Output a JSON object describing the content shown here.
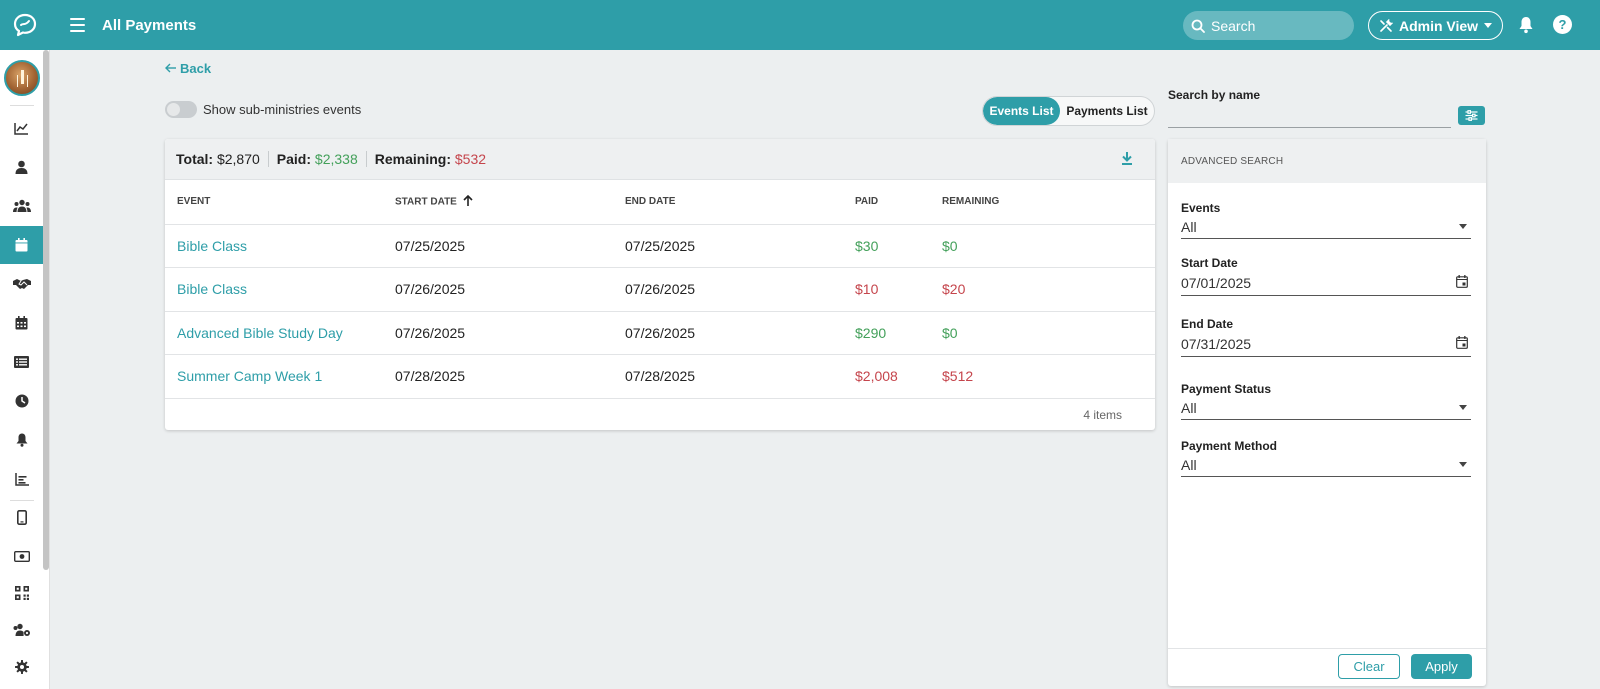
{
  "header": {
    "title": "All Payments",
    "search_placeholder": "Search",
    "admin_view_label": "Admin View",
    "help_label": "?"
  },
  "sidebar": {
    "items": [
      {
        "icon": "line-chart-icon"
      },
      {
        "icon": "person-icon"
      },
      {
        "icon": "group-icon"
      },
      {
        "icon": "calendar-icon",
        "active": true
      },
      {
        "icon": "handshake-icon"
      },
      {
        "icon": "calendar-grid-icon"
      },
      {
        "icon": "list-icon"
      },
      {
        "icon": "clock-icon"
      },
      {
        "icon": "bell-icon"
      },
      {
        "icon": "bar-chart-icon"
      },
      {
        "icon": "phone-icon"
      },
      {
        "icon": "money-icon"
      },
      {
        "icon": "qr-code-icon"
      },
      {
        "icon": "users-gear-icon"
      },
      {
        "icon": "gear-icon"
      }
    ]
  },
  "main": {
    "back_label": "Back",
    "toggle_label": "Show sub-ministries events",
    "view_tabs": [
      {
        "label": "Events List",
        "active": true
      },
      {
        "label": "Payments List",
        "active": false
      }
    ],
    "summary": {
      "total_label": "Total:",
      "total_value": "$2,870",
      "paid_label": "Paid:",
      "paid_value": "$2,338",
      "remaining_label": "Remaining:",
      "remaining_value": "$532"
    },
    "table": {
      "columns": [
        "EVENT",
        "START DATE",
        "END DATE",
        "PAID",
        "REMAINING"
      ],
      "rows": [
        {
          "event": "Bible Class",
          "start": "07/25/2025",
          "end": "07/25/2025",
          "paid": "$30",
          "remaining": "$0",
          "paid_status": "green",
          "remaining_status": "green"
        },
        {
          "event": "Bible Class",
          "start": "07/26/2025",
          "end": "07/26/2025",
          "paid": "$10",
          "remaining": "$20",
          "paid_status": "red",
          "remaining_status": "red"
        },
        {
          "event": "Advanced Bible Study Day",
          "start": "07/26/2025",
          "end": "07/26/2025",
          "paid": "$290",
          "remaining": "$0",
          "paid_status": "green",
          "remaining_status": "green"
        },
        {
          "event": "Summer Camp Week 1",
          "start": "07/28/2025",
          "end": "07/28/2025",
          "paid": "$2,008",
          "remaining": "$512",
          "paid_status": "red",
          "remaining_status": "red"
        }
      ],
      "footer": "4 items"
    }
  },
  "right_panel": {
    "search_by_name_label": "Search by name",
    "search_by_name_value": "",
    "advanced_title": "ADVANCED SEARCH",
    "fields": {
      "events_label": "Events",
      "events_value": "All",
      "start_date_label": "Start Date",
      "start_date_value": "07/01/2025",
      "end_date_label": "End Date",
      "end_date_value": "07/31/2025",
      "payment_status_label": "Payment Status",
      "payment_status_value": "All",
      "payment_method_label": "Payment Method",
      "payment_method_value": "All"
    },
    "clear_label": "Clear",
    "apply_label": "Apply"
  },
  "colors": {
    "accent": "#2e9ea8",
    "paid_green": "#43a05a",
    "due_red": "#c5454c"
  }
}
